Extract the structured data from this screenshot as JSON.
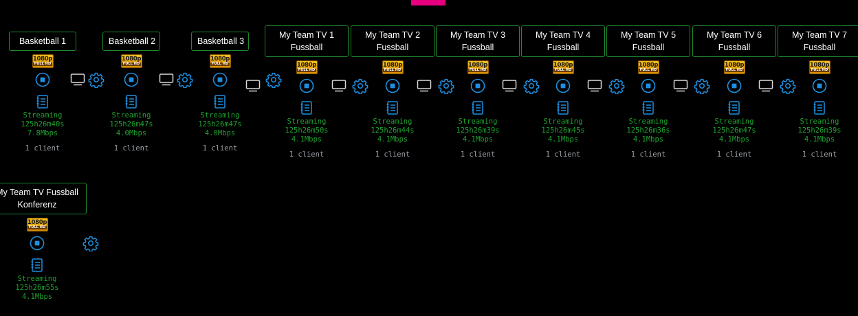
{
  "colors": {
    "background": "#000000",
    "accent_bar": "#e6007e",
    "border": "#1e8a2e",
    "status_text": "#1fa12f",
    "icon_stroke": "#1e8fe0",
    "monitor_stroke": "#d9d9d9"
  },
  "icons": {
    "monitor": "monitor-icon",
    "stop": "stop-circle-icon",
    "settings": "gear-icon",
    "log": "log-notepad-icon",
    "quality": "1080p-full-hd-badge"
  },
  "channels": [
    {
      "title_line1": "Basketball 1",
      "title_line2": "",
      "badge_top": "1080p",
      "badge_bottom": "FULL HD",
      "status": "Streaming",
      "uptime": "125h26m40s",
      "bitrate": "7.8Mbps",
      "clients": "1 client"
    },
    {
      "title_line1": "Basketball 2",
      "title_line2": "",
      "badge_top": "1080p",
      "badge_bottom": "FULL HD",
      "status": "Streaming",
      "uptime": "125h26m47s",
      "bitrate": "4.0Mbps",
      "clients": "1 client"
    },
    {
      "title_line1": "Basketball 3",
      "title_line2": "",
      "badge_top": "1080p",
      "badge_bottom": "FULL HD",
      "status": "Streaming",
      "uptime": "125h26m47s",
      "bitrate": "4.0Mbps",
      "clients": "1 client"
    },
    {
      "title_line1": "My Team TV 1",
      "title_line2": "Fussball",
      "badge_top": "1080p",
      "badge_bottom": "FULL HD",
      "status": "Streaming",
      "uptime": "125h26m50s",
      "bitrate": "4.1Mbps",
      "clients": "1 client"
    },
    {
      "title_line1": "My Team TV 2",
      "title_line2": "Fussball",
      "badge_top": "1080p",
      "badge_bottom": "FULL HD",
      "status": "Streaming",
      "uptime": "125h26m44s",
      "bitrate": "4.1Mbps",
      "clients": "1 client"
    },
    {
      "title_line1": "My Team TV 3",
      "title_line2": "Fussball",
      "badge_top": "1080p",
      "badge_bottom": "FULL HD",
      "status": "Streaming",
      "uptime": "125h26m39s",
      "bitrate": "4.1Mbps",
      "clients": "1 client"
    },
    {
      "title_line1": "My Team TV 4",
      "title_line2": "Fussball",
      "badge_top": "1080p",
      "badge_bottom": "FULL HD",
      "status": "Streaming",
      "uptime": "125h26m45s",
      "bitrate": "4.1Mbps",
      "clients": "1 client"
    },
    {
      "title_line1": "My Team TV 5",
      "title_line2": "Fussball",
      "badge_top": "1080p",
      "badge_bottom": "FULL HD",
      "status": "Streaming",
      "uptime": "125h26m36s",
      "bitrate": "4.1Mbps",
      "clients": "1 client"
    },
    {
      "title_line1": "My Team TV 6",
      "title_line2": "Fussball",
      "badge_top": "1080p",
      "badge_bottom": "FULL HD",
      "status": "Streaming",
      "uptime": "125h26m47s",
      "bitrate": "4.1Mbps",
      "clients": "1 client"
    },
    {
      "title_line1": "My Team TV 7",
      "title_line2": "Fussball",
      "badge_top": "1080p",
      "badge_bottom": "FULL HD",
      "status": "Streaming",
      "uptime": "125h26m39s",
      "bitrate": "4.1Mbps",
      "clients": "1 client"
    },
    {
      "title_line1": "My Team TV Fussball",
      "title_line2": "Konferenz",
      "badge_top": "1080p",
      "badge_bottom": "FULL HD",
      "status": "Streaming",
      "uptime": "125h26m55s",
      "bitrate": "4.1Mbps",
      "clients": ""
    }
  ]
}
